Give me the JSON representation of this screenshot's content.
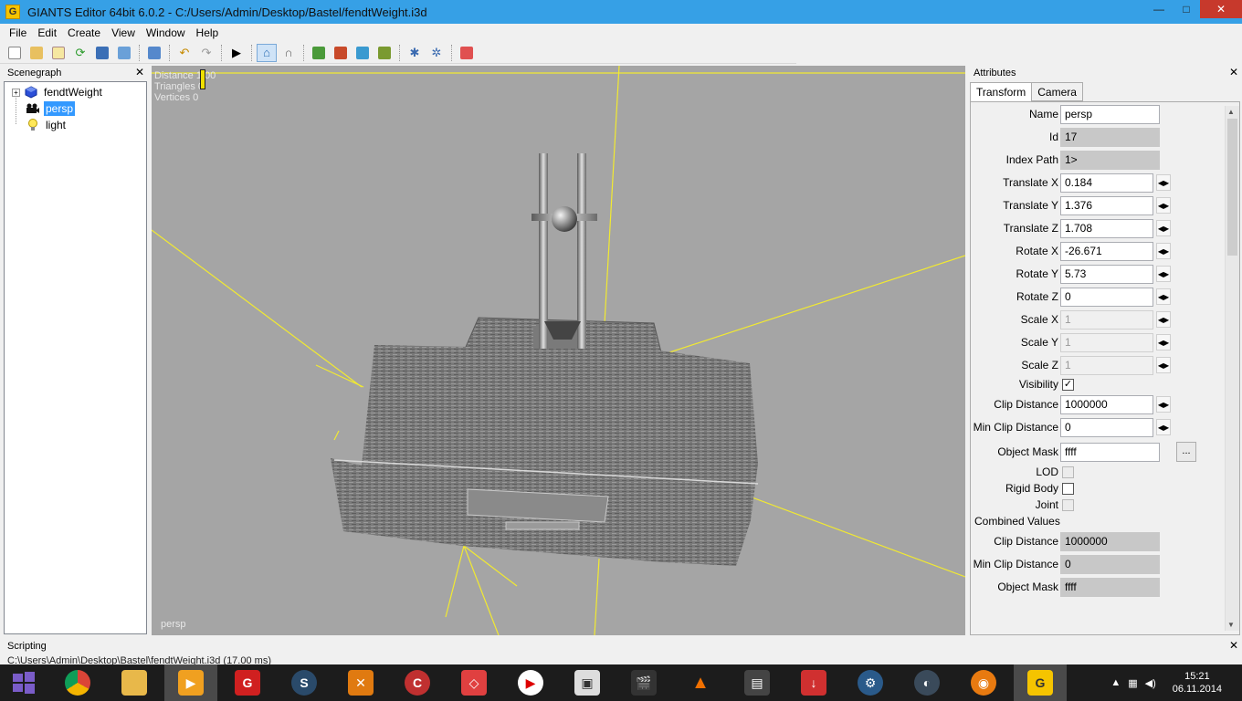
{
  "window": {
    "title": "GIANTS Editor 64bit 6.0.2 - C:/Users/Admin/Desktop/Bastel/fendtWeight.i3d",
    "app_icon_letter": "G",
    "minimize": "—",
    "maximize": "□",
    "close": "✕"
  },
  "menu": [
    "File",
    "Edit",
    "Create",
    "View",
    "Window",
    "Help"
  ],
  "scenegraph": {
    "title": "Scenegraph",
    "close": "✕",
    "nodes": [
      {
        "label": "fendtWeight",
        "expander": "+"
      },
      {
        "label": "persp"
      },
      {
        "label": "light"
      }
    ]
  },
  "viewport": {
    "stats": [
      "Distance 1.00",
      "Triangles 0",
      "Vertices 0"
    ],
    "camera_label": "persp"
  },
  "attributes": {
    "title": "Attributes",
    "close": "✕",
    "tabs": [
      "Transform",
      "Camera"
    ],
    "fields": {
      "name": {
        "label": "Name",
        "value": "persp"
      },
      "id": {
        "label": "Id",
        "value": "17"
      },
      "index_path": {
        "label": "Index Path",
        "value": "1>"
      },
      "translate_x": {
        "label": "Translate X",
        "value": "0.184"
      },
      "translate_y": {
        "label": "Translate Y",
        "value": "1.376"
      },
      "translate_z": {
        "label": "Translate Z",
        "value": "1.708"
      },
      "rotate_x": {
        "label": "Rotate X",
        "value": "-26.671"
      },
      "rotate_y": {
        "label": "Rotate Y",
        "value": "5.73"
      },
      "rotate_z": {
        "label": "Rotate Z",
        "value": "0"
      },
      "scale_x": {
        "label": "Scale X",
        "value": "1"
      },
      "scale_y": {
        "label": "Scale Y",
        "value": "1"
      },
      "scale_z": {
        "label": "Scale Z",
        "value": "1"
      },
      "visibility": {
        "label": "Visibility",
        "checked": true,
        "mark": "✓"
      },
      "clip_distance": {
        "label": "Clip Distance",
        "value": "1000000"
      },
      "min_clip_distance": {
        "label": "Min Clip Distance",
        "value": "0"
      },
      "object_mask": {
        "label": "Object Mask",
        "value": "ffff",
        "button": "..."
      },
      "lod": {
        "label": "LOD"
      },
      "rigid_body": {
        "label": "Rigid Body"
      },
      "joint": {
        "label": "Joint"
      },
      "combined_values": {
        "label": "Combined Values"
      },
      "c_clip_distance": {
        "label": "Clip Distance",
        "value": "1000000"
      },
      "c_min_clip_distance": {
        "label": "Min Clip Distance",
        "value": "0"
      },
      "c_object_mask": {
        "label": "Object Mask",
        "value": "ffff"
      }
    }
  },
  "scripting": {
    "title": "Scripting",
    "close": "✕",
    "log": "C:\\Users\\Admin\\Desktop\\Bastel\\fendtWeight.i3d (17.00 ms)"
  },
  "taskbar": {
    "time": "15:21",
    "date": "06.11.2014"
  }
}
